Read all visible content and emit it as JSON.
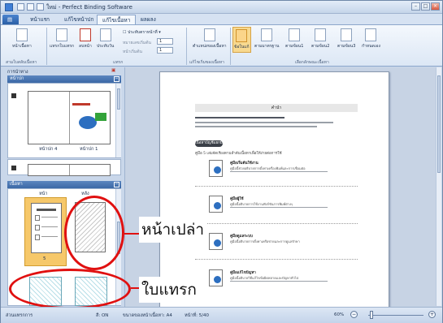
{
  "window": {
    "title": "ใหม่ - Perfect Binding Software",
    "controls": {
      "minimize": "–",
      "maximize": "□",
      "close": "×"
    }
  },
  "ribbon": {
    "tabs": [
      "หน้าแรก",
      "แก้ไขหน้าปก",
      "แก้ไขเนื้อหา",
      "ผลผลง"
    ],
    "active_tab_index": 2,
    "buttons": {
      "content_page": "หน้าเนื้อหา",
      "insert_sheet": "แทรกใบแทรก",
      "delete": "ลบหน้า",
      "page_settings": "ประทับวัน",
      "page_start": "ประทับตราหน้าที่",
      "start_at": "หมายเลขเริ่มต้น",
      "page_start_value": "1",
      "position_label": "หน้าเริ่มต้น",
      "position_value": "1",
      "content_position": "ตำแหน่งของเนื้อหา",
      "single_page": "ข้อในแก้",
      "standard": "ตามมาตรฐาน",
      "variant1": "ตามข้อน1",
      "variant2": "ตามข้อน2",
      "variant3": "ตามข้อน3",
      "custom": "กำหนดเอง"
    },
    "groups": {
      "content_arrange": "สามใบสลับเนื้อหา",
      "insert": "แทรก",
      "content_setup": "แก้ไขเริ่มของเนื้อหา",
      "layout": "เลือกลักษณะเนื้อหา"
    }
  },
  "left_pane": {
    "nav_label": "การนำทาง",
    "cover_header": "หน้าปก",
    "cover_captions": [
      "หน้าปก 4",
      "หน้าปก 1"
    ],
    "content_header": "เนื้อหา",
    "content_columns": [
      "หน้า",
      "หลัง"
    ],
    "content_page_number": "5"
  },
  "document": {
    "title": "คำนำ",
    "section_pill": "เนื้อหาบัญชีแยกมี",
    "section_note": "คู่มือ 5 เล่มจัดเรียงตามลำดับเนื้อหาเพื่อให้ง่ายต่อการใช้",
    "entries": [
      {
        "title": "คู่มือเริ่มต้นใช้งาน",
        "text": "คู่มือนี้ช่วยอธิบายการตั้งค่าเครื่องพิมพ์และการเชื่อมต่อ"
      },
      {
        "title": "คู่มือผู้ใช้",
        "text": "คู่มือนี้อธิบายการใช้งานฟังก์ชันการพิมพ์ต่างๆ"
      },
      {
        "title": "คู่มือดูแลระบบ",
        "text": "คู่มือนี้อธิบายการตั้งค่าเครือข่ายและการดูแลรักษา"
      },
      {
        "title": "คู่มือแก้ไขปัญหา",
        "text": "คู่มือนี้อธิบายวิธีแก้ไขข้อผิดพลาดและปัญหาทั่วไป"
      }
    ]
  },
  "callouts": {
    "blank_page": "หน้าเปล่า",
    "insert_sheet": "ใบแทรก"
  },
  "status_bar": {
    "mode": "ส่วนแทรกการ",
    "color": "สี: ON",
    "paper": "ขนาดของหน้าเนื้อหา: A4",
    "page": "หน้าที่: 5/40",
    "zoom": "60%",
    "zoom_out": "−",
    "zoom_in": "+"
  },
  "colors": {
    "accent": "#3b68a6",
    "callout": "#e01010",
    "selected": "#fbd58a"
  }
}
